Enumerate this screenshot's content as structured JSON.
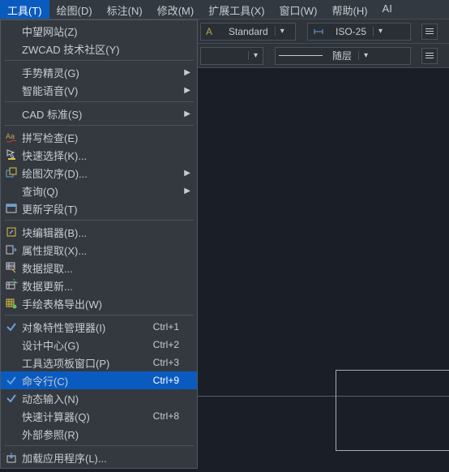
{
  "menubar": {
    "items": [
      {
        "label": "工具(T)",
        "active": true
      },
      {
        "label": "绘图(D)"
      },
      {
        "label": "标注(N)"
      },
      {
        "label": "修改(M)"
      },
      {
        "label": "扩展工具(X)"
      },
      {
        "label": "窗口(W)"
      },
      {
        "label": "帮助(H)"
      },
      {
        "label": "AI"
      }
    ]
  },
  "toolbar": {
    "style_combo": "Standard",
    "dim_combo": "ISO-25",
    "layer_combo": "随层"
  },
  "menu": {
    "groups": [
      [
        {
          "label": "中望网站(Z)",
          "icon": "",
          "sub": false
        },
        {
          "label": "ZWCAD 技术社区(Y)",
          "icon": "",
          "sub": false
        }
      ],
      [
        {
          "label": "手势精灵(G)",
          "icon": "",
          "sub": true
        },
        {
          "label": "智能语音(V)",
          "icon": "",
          "sub": true
        }
      ],
      [
        {
          "label": "CAD 标准(S)",
          "icon": "",
          "sub": true
        }
      ],
      [
        {
          "label": "拼写检查(E)",
          "icon": "spellcheck",
          "sub": false
        },
        {
          "label": "快速选择(K)...",
          "icon": "quick-select",
          "sub": false
        },
        {
          "label": "绘图次序(D)...",
          "icon": "draw-order",
          "sub": true
        },
        {
          "label": "查询(Q)",
          "icon": "",
          "sub": true
        },
        {
          "label": "更新字段(T)",
          "icon": "update-field",
          "sub": false
        }
      ],
      [
        {
          "label": "块编辑器(B)...",
          "icon": "block-editor",
          "sub": false
        },
        {
          "label": "属性提取(X)...",
          "icon": "attr-extract",
          "sub": false
        },
        {
          "label": "数据提取...",
          "icon": "data-extract",
          "sub": false
        },
        {
          "label": "数据更新...",
          "icon": "data-update",
          "sub": false
        },
        {
          "label": "手绘表格导出(W)",
          "icon": "table-export",
          "sub": false
        }
      ],
      [
        {
          "label": "对象特性管理器(I)",
          "icon": "check",
          "shortcut": "Ctrl+1",
          "sub": false
        },
        {
          "label": "设计中心(G)",
          "icon": "",
          "shortcut": "Ctrl+2",
          "sub": false
        },
        {
          "label": "工具选项板窗口(P)",
          "icon": "",
          "shortcut": "Ctrl+3",
          "sub": false
        },
        {
          "label": "命令行(C)",
          "icon": "check",
          "shortcut": "Ctrl+9",
          "highlight": true,
          "sub": false
        },
        {
          "label": "动态输入(N)",
          "icon": "check",
          "sub": false
        },
        {
          "label": "快速计算器(Q)",
          "icon": "",
          "shortcut": "Ctrl+8",
          "sub": false
        },
        {
          "label": "外部参照(R)",
          "icon": "",
          "sub": false
        }
      ],
      [
        {
          "label": "加载应用程序(L)...",
          "icon": "load-app",
          "sub": false
        }
      ]
    ]
  }
}
